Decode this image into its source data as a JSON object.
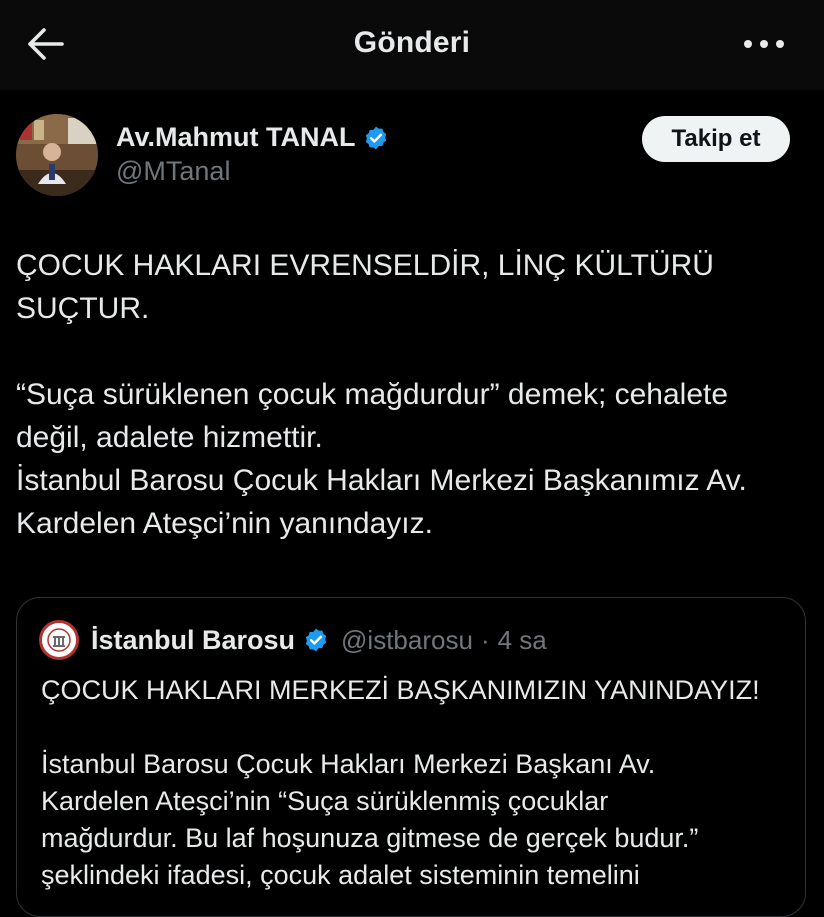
{
  "header": {
    "title": "Gönderi"
  },
  "post": {
    "author_name": "Av.Mahmut TANAL",
    "author_handle": "@MTanal",
    "follow_label": "Takip et",
    "paragraph_1": "ÇOCUK HAKLARI EVRENSELDİR, LİNÇ KÜLTÜRÜ\nSUÇTUR.",
    "paragraph_2": "“Suça sürüklenen çocuk mağdurdur” demek; cehalete\ndeğil, adalete hizmettir.\nİstanbul Barosu Çocuk Hakları Merkezi Başkanımız Av.\nKardelen Ateşci’nin yanındayız."
  },
  "quote": {
    "author_name": "İstanbul Barosu",
    "author_handle": "@istbarosu",
    "separator": "·",
    "time": "4 sa",
    "paragraph_1": "ÇOCUK HAKLARI MERKEZİ BAŞKANIMIZIN YANINDAYIZ!",
    "paragraph_2": "İstanbul Barosu Çocuk Hakları Merkezi Başkanı Av.\nKardelen Ateşci’nin “Suça sürüklenmiş çocuklar\nmağdurdur. Bu laf hoşunuza gitmese de gerçek budur.”\nşeklindeki ifadesi, çocuk adalet sisteminin temelini"
  },
  "icons": {
    "back": "arrow-left-icon",
    "more": "more-horizontal-icon",
    "verified": "verified-badge-icon"
  },
  "colors": {
    "background": "#000000",
    "text_primary": "#e7e9ea",
    "text_secondary": "#71767b",
    "verified_blue": "#1d9bf0",
    "follow_button_bg": "#eff3f4",
    "border": "#2f3336"
  }
}
